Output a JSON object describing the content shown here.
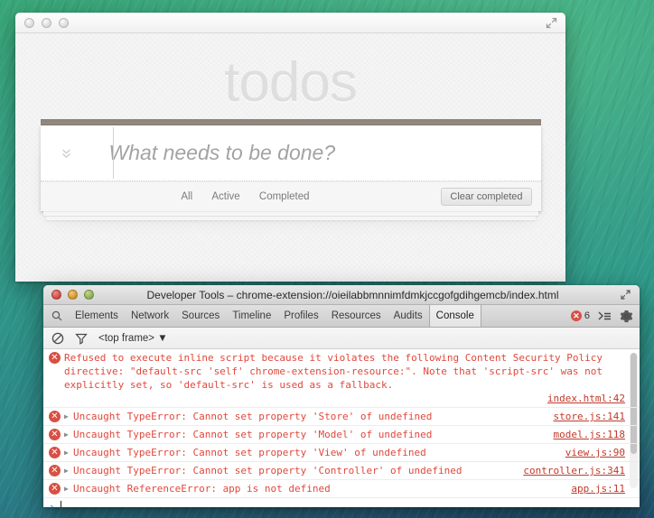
{
  "desktop": {
    "wallpaper_name": "macos-wave-wallpaper"
  },
  "app_window": {
    "title": "",
    "traffic_lights": [
      "close",
      "minimize",
      "zoom"
    ],
    "fullscreen_icon": "fullscreen-icon",
    "heading": "todos",
    "toggle_all_icon": "»",
    "new_todo_placeholder": "What needs to be done?",
    "new_todo_value": "",
    "filters": [
      {
        "label": "All",
        "active": false
      },
      {
        "label": "Active",
        "active": false
      },
      {
        "label": "Completed",
        "active": false
      }
    ],
    "clear_completed_label": "Clear completed"
  },
  "devtools": {
    "traffic_lights": [
      {
        "name": "close",
        "color": "#c9453c"
      },
      {
        "name": "minimize",
        "color": "#cf8f23"
      },
      {
        "name": "zoom",
        "color": "#86a84c"
      }
    ],
    "title": "Developer Tools – chrome-extension://oieilabbmnnimfdmkjccgofgdihgemcb/index.html",
    "expand_icon": "expand-icon",
    "search_icon": "search-icon",
    "tabs": [
      {
        "label": "Elements",
        "active": false
      },
      {
        "label": "Network",
        "active": false
      },
      {
        "label": "Sources",
        "active": false
      },
      {
        "label": "Timeline",
        "active": false
      },
      {
        "label": "Profiles",
        "active": false
      },
      {
        "label": "Resources",
        "active": false
      },
      {
        "label": "Audits",
        "active": false
      },
      {
        "label": "Console",
        "active": true
      }
    ],
    "error_count": "6",
    "drawer_icon": "drawer-toggle-icon",
    "settings_icon": "gear-icon",
    "toolbar": {
      "clear_icon": "clear-console-icon",
      "filter_icon": "filter-icon",
      "frame_selector": "<top frame> ▼"
    },
    "console_messages": [
      {
        "level": "error",
        "icon": "error-icon",
        "expandable": false,
        "text": "Refused to execute inline script because it violates the following Content Security Policy directive: \"default-src 'self' chrome-extension-resource:\". Note that 'script-src' was not explicitly set, so 'default-src' is used as a fallback.",
        "link": "index.html:42"
      },
      {
        "level": "error",
        "icon": "error-icon",
        "expandable": true,
        "text": "Uncaught TypeError: Cannot set property 'Store' of undefined",
        "link": "store.js:141"
      },
      {
        "level": "error",
        "icon": "error-icon",
        "expandable": true,
        "text": "Uncaught TypeError: Cannot set property 'Model' of undefined",
        "link": "model.js:118"
      },
      {
        "level": "error",
        "icon": "error-icon",
        "expandable": true,
        "text": "Uncaught TypeError: Cannot set property 'View' of undefined",
        "link": "view.js:90"
      },
      {
        "level": "error",
        "icon": "error-icon",
        "expandable": true,
        "text": "Uncaught TypeError: Cannot set property 'Controller' of undefined",
        "link": "controller.js:341"
      },
      {
        "level": "error",
        "icon": "error-icon",
        "expandable": true,
        "text": "Uncaught ReferenceError: app is not defined",
        "link": "app.js:11"
      }
    ],
    "prompt": {
      "caret": "›",
      "value": ""
    }
  },
  "colors": {
    "error_red": "#e0483c",
    "error_badge": "#d94f43",
    "prompt_blue": "#3e7fd4",
    "todos_title": "#dedede"
  }
}
